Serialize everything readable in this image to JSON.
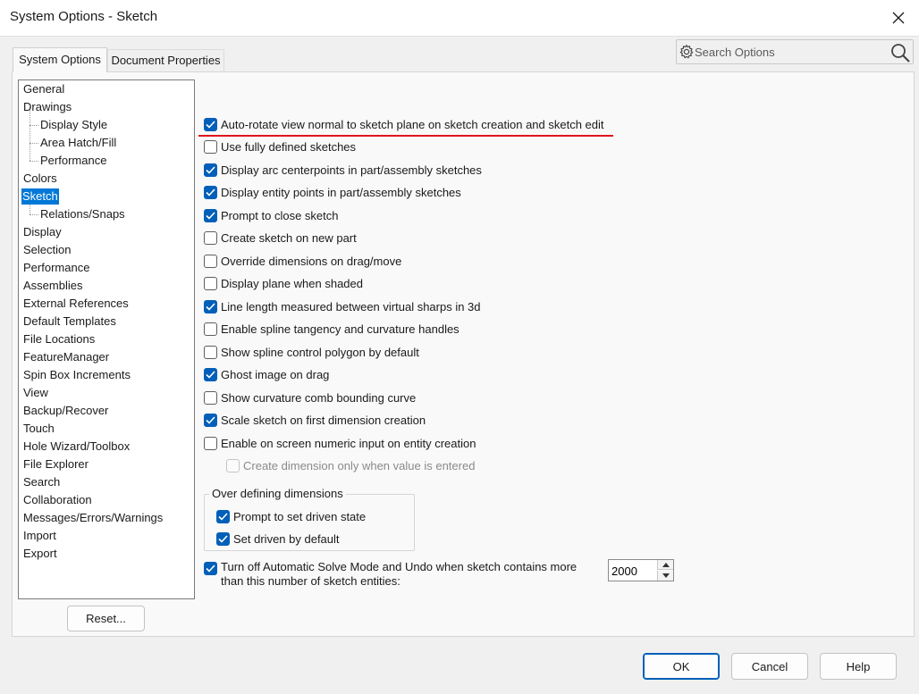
{
  "window": {
    "title": "System Options - Sketch",
    "close_icon": "close-icon"
  },
  "tabs": [
    {
      "label": "System Options",
      "active": true
    },
    {
      "label": "Document Properties",
      "active": false
    }
  ],
  "search": {
    "placeholder": "Search Options",
    "value": "",
    "icons": [
      "gear-icon",
      "magnifier-icon"
    ]
  },
  "tree": {
    "items": [
      {
        "label": "General",
        "level": 0,
        "selected": false
      },
      {
        "label": "Drawings",
        "level": 0,
        "selected": false
      },
      {
        "label": "Display Style",
        "level": 1,
        "selected": false
      },
      {
        "label": "Area Hatch/Fill",
        "level": 1,
        "selected": false
      },
      {
        "label": "Performance",
        "level": 1,
        "selected": false
      },
      {
        "label": "Colors",
        "level": 0,
        "selected": false
      },
      {
        "label": "Sketch",
        "level": 0,
        "selected": true
      },
      {
        "label": "Relations/Snaps",
        "level": 1,
        "selected": false
      },
      {
        "label": "Display",
        "level": 0,
        "selected": false
      },
      {
        "label": "Selection",
        "level": 0,
        "selected": false
      },
      {
        "label": "Performance",
        "level": 0,
        "selected": false
      },
      {
        "label": "Assemblies",
        "level": 0,
        "selected": false
      },
      {
        "label": "External References",
        "level": 0,
        "selected": false
      },
      {
        "label": "Default Templates",
        "level": 0,
        "selected": false
      },
      {
        "label": "File Locations",
        "level": 0,
        "selected": false
      },
      {
        "label": "FeatureManager",
        "level": 0,
        "selected": false
      },
      {
        "label": "Spin Box Increments",
        "level": 0,
        "selected": false
      },
      {
        "label": "View",
        "level": 0,
        "selected": false
      },
      {
        "label": "Backup/Recover",
        "level": 0,
        "selected": false
      },
      {
        "label": "Touch",
        "level": 0,
        "selected": false
      },
      {
        "label": "Hole Wizard/Toolbox",
        "level": 0,
        "selected": false
      },
      {
        "label": "File Explorer",
        "level": 0,
        "selected": false
      },
      {
        "label": "Search",
        "level": 0,
        "selected": false
      },
      {
        "label": "Collaboration",
        "level": 0,
        "selected": false
      },
      {
        "label": "Messages/Errors/Warnings",
        "level": 0,
        "selected": false
      },
      {
        "label": "Import",
        "level": 0,
        "selected": false
      },
      {
        "label": "Export",
        "level": 0,
        "selected": false
      }
    ],
    "reset_label": "Reset..."
  },
  "options": [
    {
      "label": "Auto-rotate view normal to sketch plane on sketch creation and sketch edit",
      "checked": true,
      "enabled": true
    },
    {
      "label": "Use fully defined sketches",
      "checked": false,
      "enabled": true
    },
    {
      "label": "Display arc centerpoints in part/assembly sketches",
      "checked": true,
      "enabled": true
    },
    {
      "label": "Display entity points in part/assembly sketches",
      "checked": true,
      "enabled": true
    },
    {
      "label": "Prompt to close sketch",
      "checked": true,
      "enabled": true
    },
    {
      "label": "Create sketch on new part",
      "checked": false,
      "enabled": true
    },
    {
      "label": "Override dimensions on drag/move",
      "checked": false,
      "enabled": true
    },
    {
      "label": "Display plane when shaded",
      "checked": false,
      "enabled": true
    },
    {
      "label": "Line length measured between virtual sharps in 3d",
      "checked": true,
      "enabled": true
    },
    {
      "label": "Enable spline tangency and curvature handles",
      "checked": false,
      "enabled": true
    },
    {
      "label": "Show spline control polygon by default",
      "checked": false,
      "enabled": true
    },
    {
      "label": "Ghost image on drag",
      "checked": true,
      "enabled": true
    },
    {
      "label": "Show curvature comb bounding curve",
      "checked": false,
      "enabled": true
    },
    {
      "label": "Scale sketch on first dimension creation",
      "checked": true,
      "enabled": true
    },
    {
      "label": "Enable on screen numeric input on entity creation",
      "checked": false,
      "enabled": true
    },
    {
      "label": "Create dimension only when value is entered",
      "checked": false,
      "enabled": false
    }
  ],
  "over_defining": {
    "title": "Over defining dimensions",
    "options": [
      {
        "label": "Prompt to set driven state",
        "checked": true
      },
      {
        "label": "Set driven by default",
        "checked": true
      }
    ]
  },
  "auto_solve": {
    "label": "Turn off Automatic Solve Mode and Undo when sketch contains more than this number of sketch entities:",
    "checked": true,
    "value": "2000"
  },
  "footer": {
    "ok": "OK",
    "cancel": "Cancel",
    "help": "Help"
  },
  "colors": {
    "accent": "#005fb8",
    "selection": "#0078d7",
    "highlight_underline": "#e0141e"
  }
}
